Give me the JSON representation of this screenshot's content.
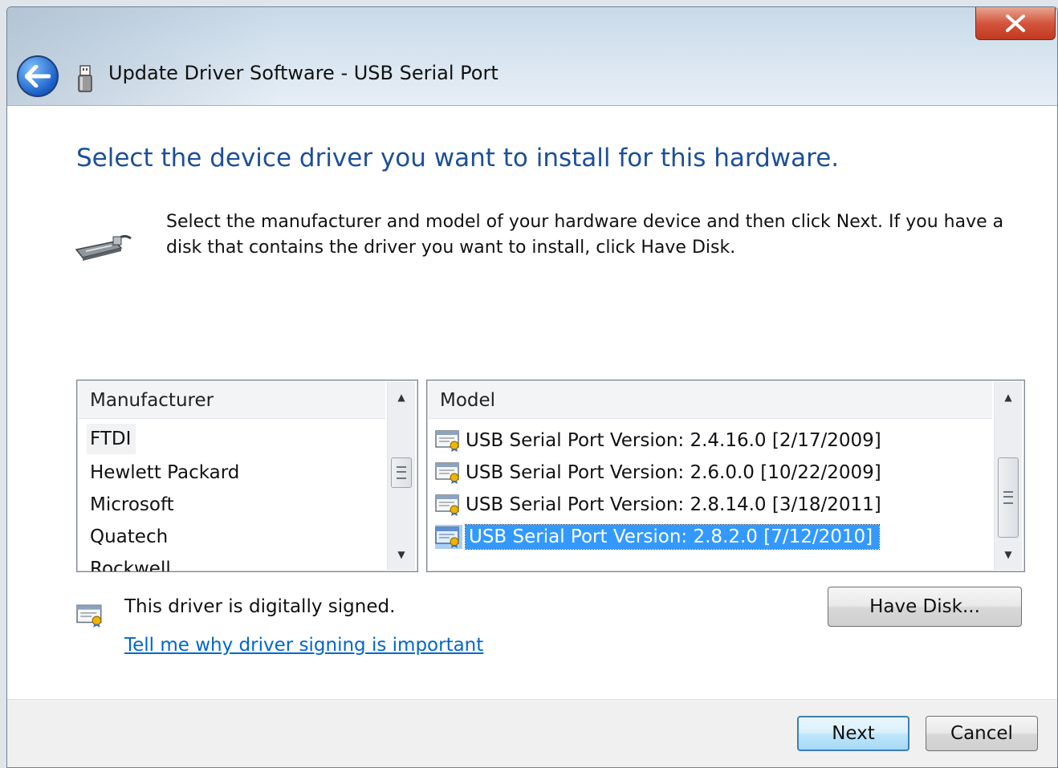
{
  "window": {
    "title": "Update Driver Software - USB Serial Port"
  },
  "heading": "Select the device driver you want to install for this hardware.",
  "instructions": "Select the manufacturer and model of your hardware device and then click Next. If you have a disk that contains the driver you want to install, click Have Disk.",
  "manufacturer_list": {
    "header": "Manufacturer",
    "items": [
      "FTDI",
      "Hewlett Packard",
      "Microsoft",
      "Quatech",
      "Rockwell"
    ],
    "selected": "FTDI"
  },
  "model_list": {
    "header": "Model",
    "items": [
      "USB Serial Port Version: 2.4.16.0 [2/17/2009]",
      "USB Serial Port Version: 2.6.0.0 [10/22/2009]",
      "USB Serial Port Version: 2.8.14.0 [3/18/2011]",
      "USB Serial Port Version: 2.8.2.0 [7/12/2010]"
    ],
    "selected": "USB Serial Port Version: 2.8.2.0 [7/12/2010]"
  },
  "signing": {
    "status": "This driver is digitally signed.",
    "link": "Tell me why driver signing is important"
  },
  "buttons": {
    "have_disk": "Have Disk...",
    "next": "Next",
    "cancel": "Cancel"
  },
  "colors": {
    "heading": "#1c4f9a",
    "link": "#0066cc",
    "selection": "#3399ff",
    "close_button": "#c0391f"
  },
  "icons": {
    "close": "close-x-icon",
    "back": "back-arrow-icon",
    "title": "usb-plug-icon",
    "hardware": "serial-port-device-icon",
    "driver": "certificate-icon"
  }
}
